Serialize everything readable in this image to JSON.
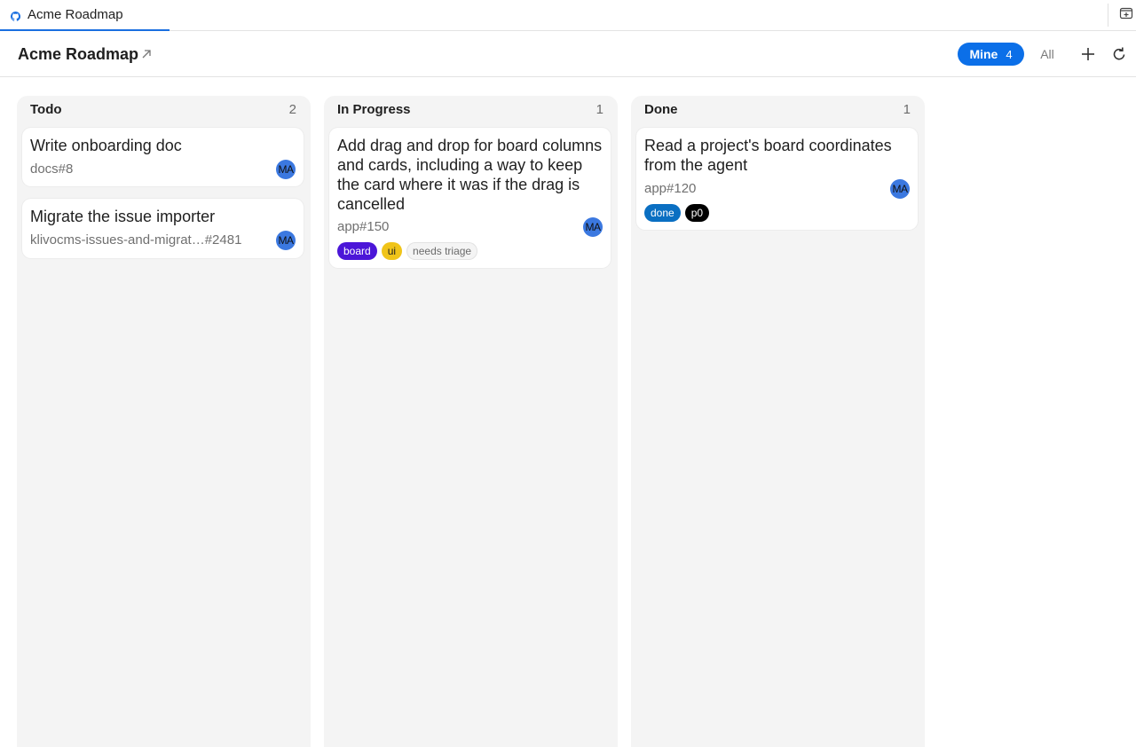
{
  "tab": {
    "label": "Acme Roadmap",
    "icon": "github-icon"
  },
  "header": {
    "title": "Acme Roadmap",
    "filters": {
      "mine_label": "Mine",
      "mine_count": "4",
      "all_label": "All"
    }
  },
  "columns": [
    {
      "name": "Todo",
      "count": "2",
      "cards": [
        {
          "title": "Write onboarding doc",
          "ref": "docs#8",
          "avatar": "MA",
          "labels": []
        },
        {
          "title": "Migrate the issue importer",
          "ref": "klivocms-issues-and-migrat…#2481",
          "avatar": "MA",
          "labels": []
        }
      ]
    },
    {
      "name": "In Progress",
      "count": "1",
      "cards": [
        {
          "title": "Add drag and drop for board columns and cards, including a way to keep the card where it was if the drag is cancelled",
          "ref": "app#150",
          "avatar": "MA",
          "labels": [
            {
              "text": "board",
              "bg": "#4b16d8",
              "fg": "#ffffff"
            },
            {
              "text": "ui",
              "bg": "#f0c419",
              "fg": "#1f1f1f"
            },
            {
              "text": "needs triage",
              "bg": "#f4f4f4",
              "fg": "#6b6b6b"
            }
          ]
        }
      ]
    },
    {
      "name": "Done",
      "count": "1",
      "cards": [
        {
          "title": "Read a project's board coordinates from the agent",
          "ref": "app#120",
          "avatar": "MA",
          "labels": [
            {
              "text": "done",
              "bg": "#0a6fc2",
              "fg": "#ffffff"
            },
            {
              "text": "p0",
              "bg": "#000000",
              "fg": "#ffffff"
            }
          ]
        }
      ]
    }
  ],
  "colors": {
    "accent": "#0b6fe8",
    "avatar": "#3b78e0",
    "column_bg": "#f4f4f4"
  }
}
